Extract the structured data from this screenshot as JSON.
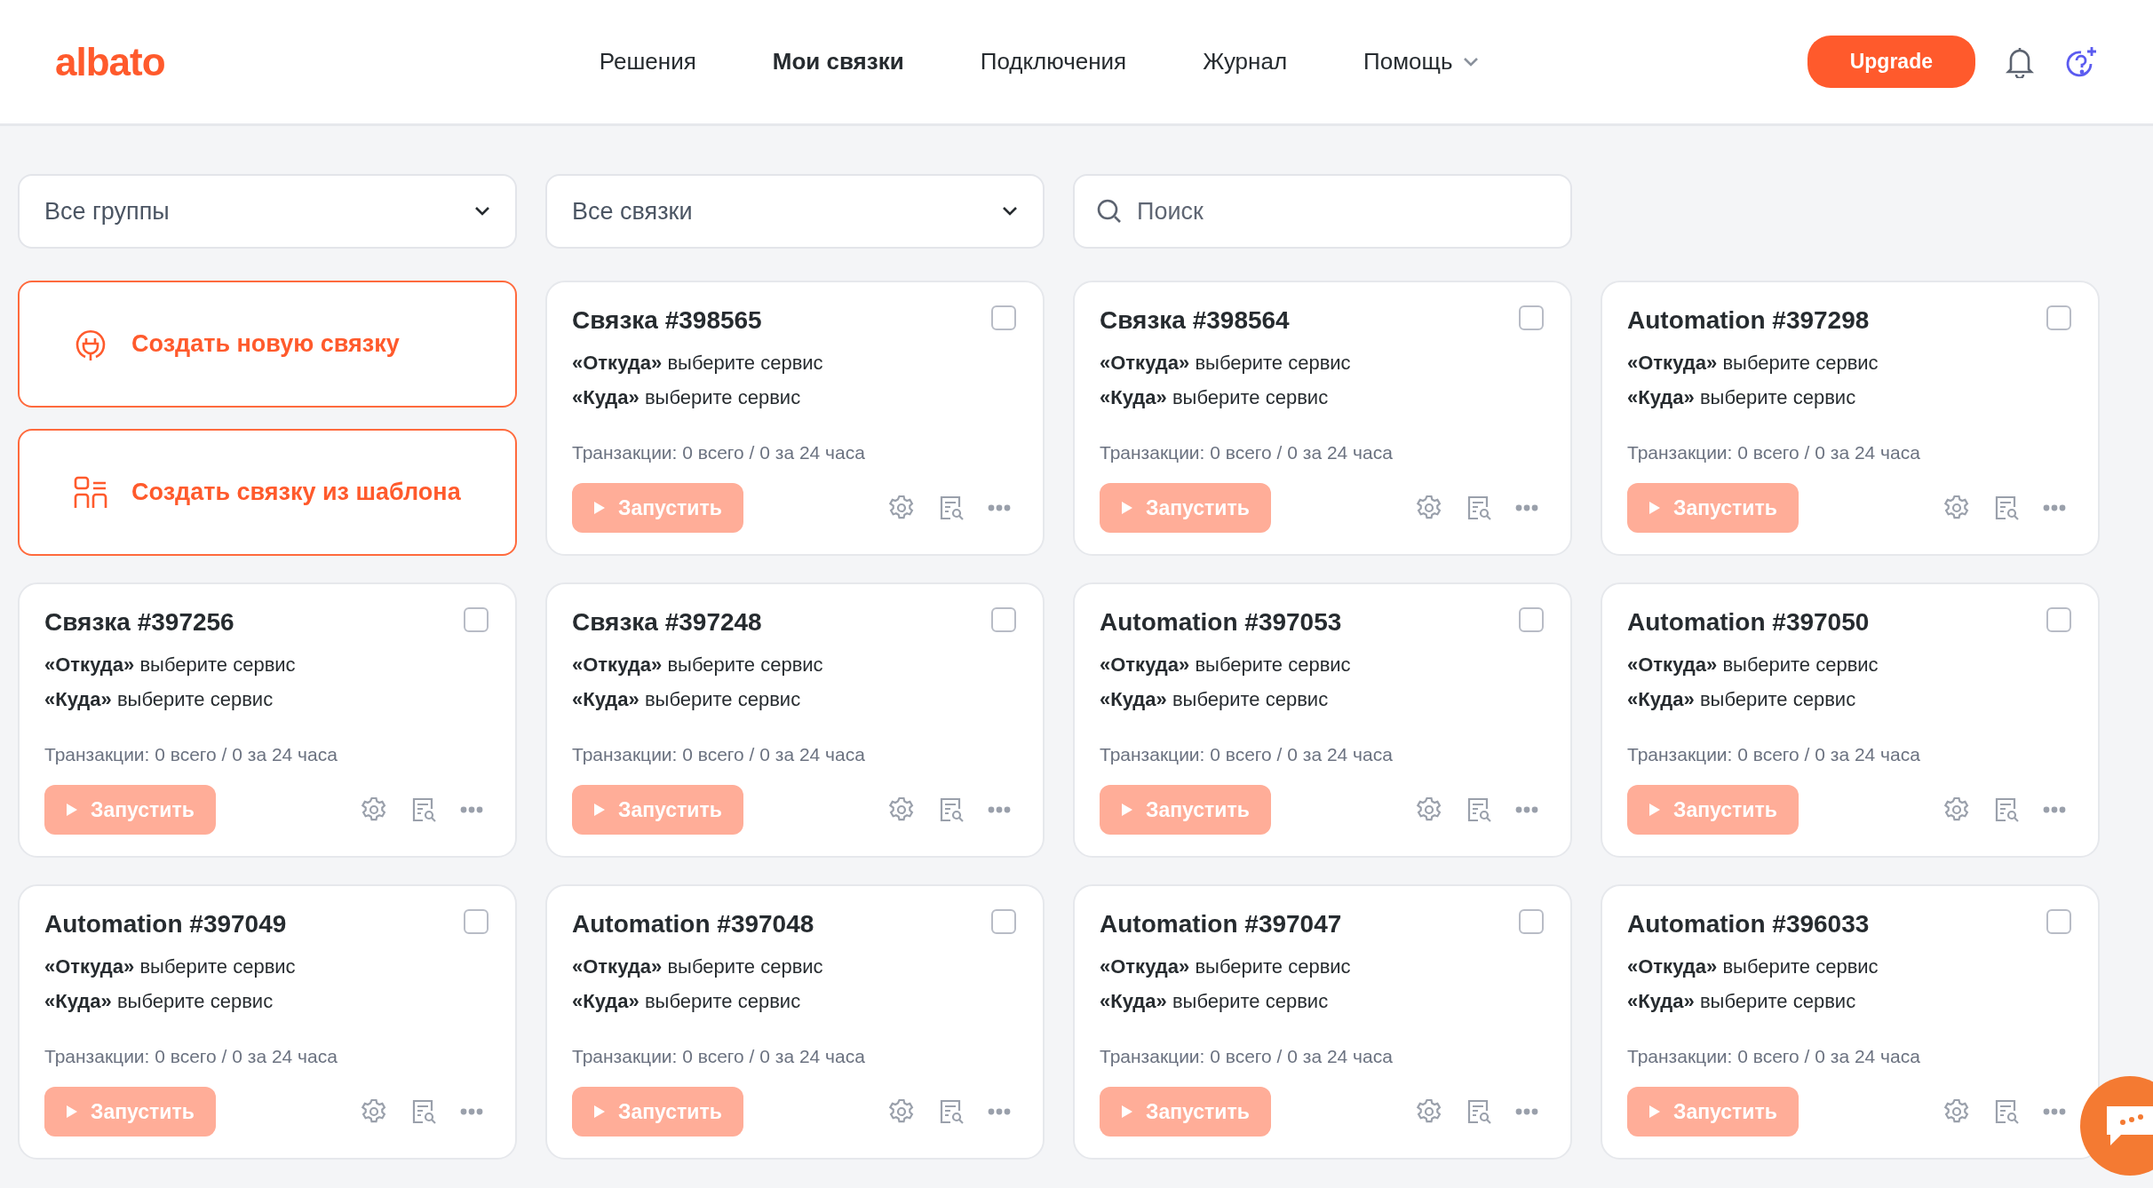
{
  "header": {
    "logo": "albato",
    "nav": [
      {
        "label": "Решения",
        "selected": false,
        "dropdown": false
      },
      {
        "label": "Мои связки",
        "selected": true,
        "dropdown": false
      },
      {
        "label": "Подключения",
        "selected": false,
        "dropdown": false
      },
      {
        "label": "Журнал",
        "selected": false,
        "dropdown": false
      },
      {
        "label": "Помощь",
        "selected": false,
        "dropdown": true
      }
    ],
    "upgrade": "Upgrade"
  },
  "filters": {
    "groups": "Все группы",
    "automations": "Все связки",
    "search": {
      "placeholder": "Поиск"
    }
  },
  "create": [
    {
      "kind": "new",
      "label": "Создать новую связку"
    },
    {
      "kind": "template",
      "label": "Создать связку из шаблона"
    }
  ],
  "cards": [
    {
      "title": "Связка #398565",
      "from": "**«Откуда»** выберите сервис",
      "to": "**«Куда»** выберите сервис",
      "transactions": "Транзакции: 0 всего / 0 за 24 часа",
      "run": "Запустить",
      "disabled": true,
      "checked": false
    },
    {
      "title": "Связка #398564",
      "from": "**«Откуда»** выберите сервис",
      "to": "**«Куда»** выберите сервис",
      "transactions": "Транзакции: 0 всего / 0 за 24 часа",
      "run": "Запустить",
      "disabled": true,
      "checked": false
    },
    {
      "title": "Automation #397298",
      "from": "**«Откуда»** выберите сервис",
      "to": "**«Куда»** выберите сервис",
      "transactions": "Транзакции: 0 всего / 0 за 24 часа",
      "run": "Запустить",
      "disabled": true,
      "checked": false
    },
    {
      "title": "Связка #397256",
      "from": "**«Откуда»** выберите сервис",
      "to": "**«Куда»** выберите сервис",
      "transactions": "Транзакции: 0 всего / 0 за 24 часа",
      "run": "Запустить",
      "disabled": true,
      "checked": false
    },
    {
      "title": "Связка #397248",
      "from": "**«Откуда»** выберите сервис",
      "to": "**«Куда»** выберите сервис",
      "transactions": "Транзакции: 0 всего / 0 за 24 часа",
      "run": "Запустить",
      "disabled": true,
      "checked": false
    },
    {
      "title": "Automation #397053",
      "from": "**«Откуда»** выберите сервис",
      "to": "**«Куда»** выберите сервис",
      "transactions": "Транзакции: 0 всего / 0 за 24 часа",
      "run": "Запустить",
      "disabled": true,
      "checked": false
    },
    {
      "title": "Automation #397050",
      "from": "**«Откуда»** выберите сервис",
      "to": "**«Куда»** выберите сервис",
      "transactions": "Транзакции: 0 всего / 0 за 24 часа",
      "run": "Запустить",
      "disabled": true,
      "checked": false
    },
    {
      "title": "Automation #397049",
      "from": "**«Откуда»** выберите сервис",
      "to": "**«Куда»** выберите сервис",
      "transactions": "Транзакции: 0 всего / 0 за 24 часа",
      "run": "Запустить",
      "disabled": true,
      "checked": false
    },
    {
      "title": "Automation #397048",
      "from": "**«Откуда»** выберите сервис",
      "to": "**«Куда»** выберите сервис",
      "transactions": "Транзакции: 0 всего / 0 за 24 часа",
      "run": "Запустить",
      "disabled": true,
      "checked": false
    },
    {
      "title": "Automation #397047",
      "from": "**«Откуда»** выберите сервис",
      "to": "**«Куда»** выберите сервис",
      "transactions": "Транзакции: 0 всего / 0 за 24 часа",
      "run": "Запустить",
      "disabled": true,
      "checked": false
    },
    {
      "title": "Automation #396033",
      "from": "**«Откуда»** выберите сервис",
      "to": "**«Куда»** выберите сервис",
      "transactions": "Транзакции: 0 всего / 0 за 24 часа",
      "run": "Запустить",
      "disabled": true,
      "checked": false
    }
  ]
}
